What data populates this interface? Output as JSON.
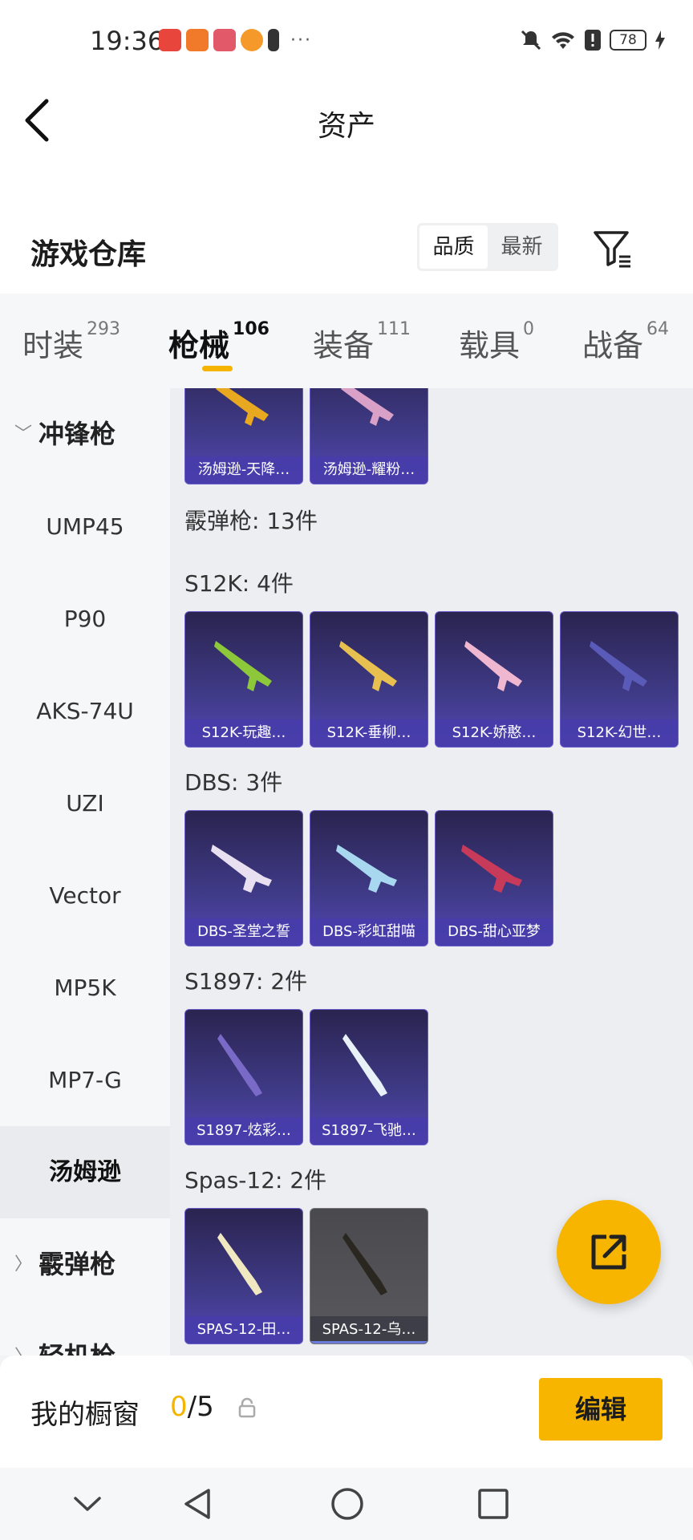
{
  "status_bar": {
    "time": "19:36",
    "battery": "78"
  },
  "header": {
    "title": "资产",
    "warehouse_title": "游戏仓库",
    "sort_options": [
      "品质",
      "最新"
    ]
  },
  "tabs": [
    {
      "label": "时装",
      "count": "293"
    },
    {
      "label": "枪械",
      "count": "106"
    },
    {
      "label": "装备",
      "count": "111"
    },
    {
      "label": "载具",
      "count": "0"
    },
    {
      "label": "战备",
      "count": "64"
    }
  ],
  "sidebar": {
    "group_smg": "冲锋枪",
    "items": [
      "UMP45",
      "P90",
      "AKS-74U",
      "UZI",
      "Vector",
      "MP5K",
      "MP7-G",
      "汤姆逊"
    ],
    "group_shotgun": "霰弹枪",
    "group_lmg": "轻机枪"
  },
  "content": {
    "top_cards": [
      "汤姆逊-天降…",
      "汤姆逊-耀粉…"
    ],
    "shotgun_header": "霰弹枪: 13件",
    "sections": [
      {
        "title": "S12K: 4件",
        "cards": [
          "S12K-玩趣…",
          "S12K-垂柳…",
          "S12K-娇憨…",
          "S12K-幻世…"
        ]
      },
      {
        "title": "DBS: 3件",
        "cards": [
          "DBS-圣堂之誓",
          "DBS-彩虹甜喵",
          "DBS-甜心亚梦"
        ]
      },
      {
        "title": "S1897: 2件",
        "cards": [
          "S1897-炫彩…",
          "S1897-飞驰…"
        ]
      },
      {
        "title": "Spas-12: 2件",
        "cards": [
          "SPAS-12-田…",
          "SPAS-12-乌…"
        ]
      }
    ]
  },
  "bottom": {
    "window_label": "我的橱窗",
    "count_current": "0",
    "count_total": "/5",
    "edit_label": "编辑"
  },
  "colors": {
    "accent": "#f7b500",
    "card_purple": "#3f3a86"
  }
}
